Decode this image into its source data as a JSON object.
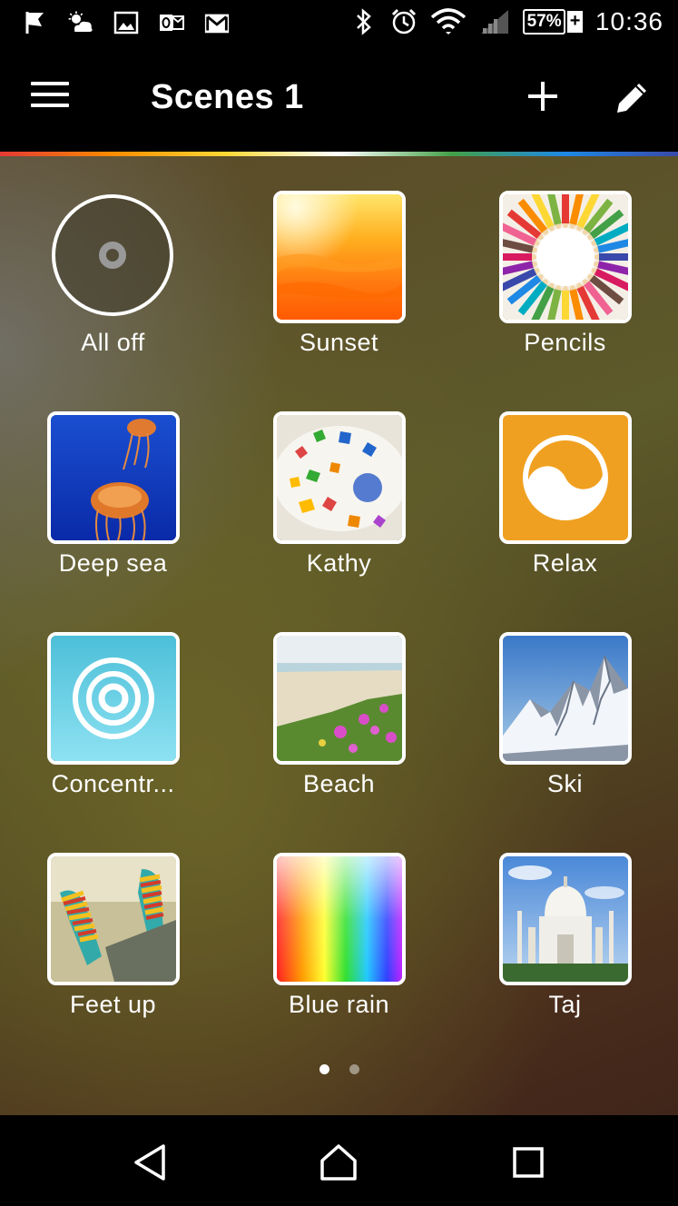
{
  "status_bar": {
    "battery_percent": "57%",
    "charging_symbol": "+",
    "time": "10:36",
    "icons_left": [
      "flag-icon",
      "weather-icon",
      "image-icon",
      "outlook-icon",
      "gmail-icon"
    ],
    "icons_right": [
      "bluetooth-icon",
      "alarm-icon",
      "wifi-icon",
      "cell-signal-icon",
      "battery-icon"
    ]
  },
  "app_bar": {
    "title": "Scenes 1",
    "icons": [
      "menu-icon",
      "add-icon",
      "edit-icon"
    ]
  },
  "scenes": [
    {
      "label": "All off",
      "name": "all-off"
    },
    {
      "label": "Sunset",
      "name": "sunset"
    },
    {
      "label": "Pencils",
      "name": "pencils"
    },
    {
      "label": "Deep sea",
      "name": "deep-sea"
    },
    {
      "label": "Kathy",
      "name": "kathy"
    },
    {
      "label": "Relax",
      "name": "relax"
    },
    {
      "label": "Concentr...",
      "name": "concentrate"
    },
    {
      "label": "Beach",
      "name": "beach"
    },
    {
      "label": "Ski",
      "name": "ski"
    },
    {
      "label": "Feet up",
      "name": "feet-up"
    },
    {
      "label": "Blue rain",
      "name": "blue-rain"
    },
    {
      "label": "Taj",
      "name": "taj"
    }
  ],
  "pager": {
    "pages": 2,
    "current": 1
  },
  "nav_bar": {
    "icons": [
      "back-icon",
      "home-icon",
      "recents-icon"
    ]
  },
  "colors": {
    "relax": "#f0a020",
    "concentrate": "#5ac8e0"
  }
}
